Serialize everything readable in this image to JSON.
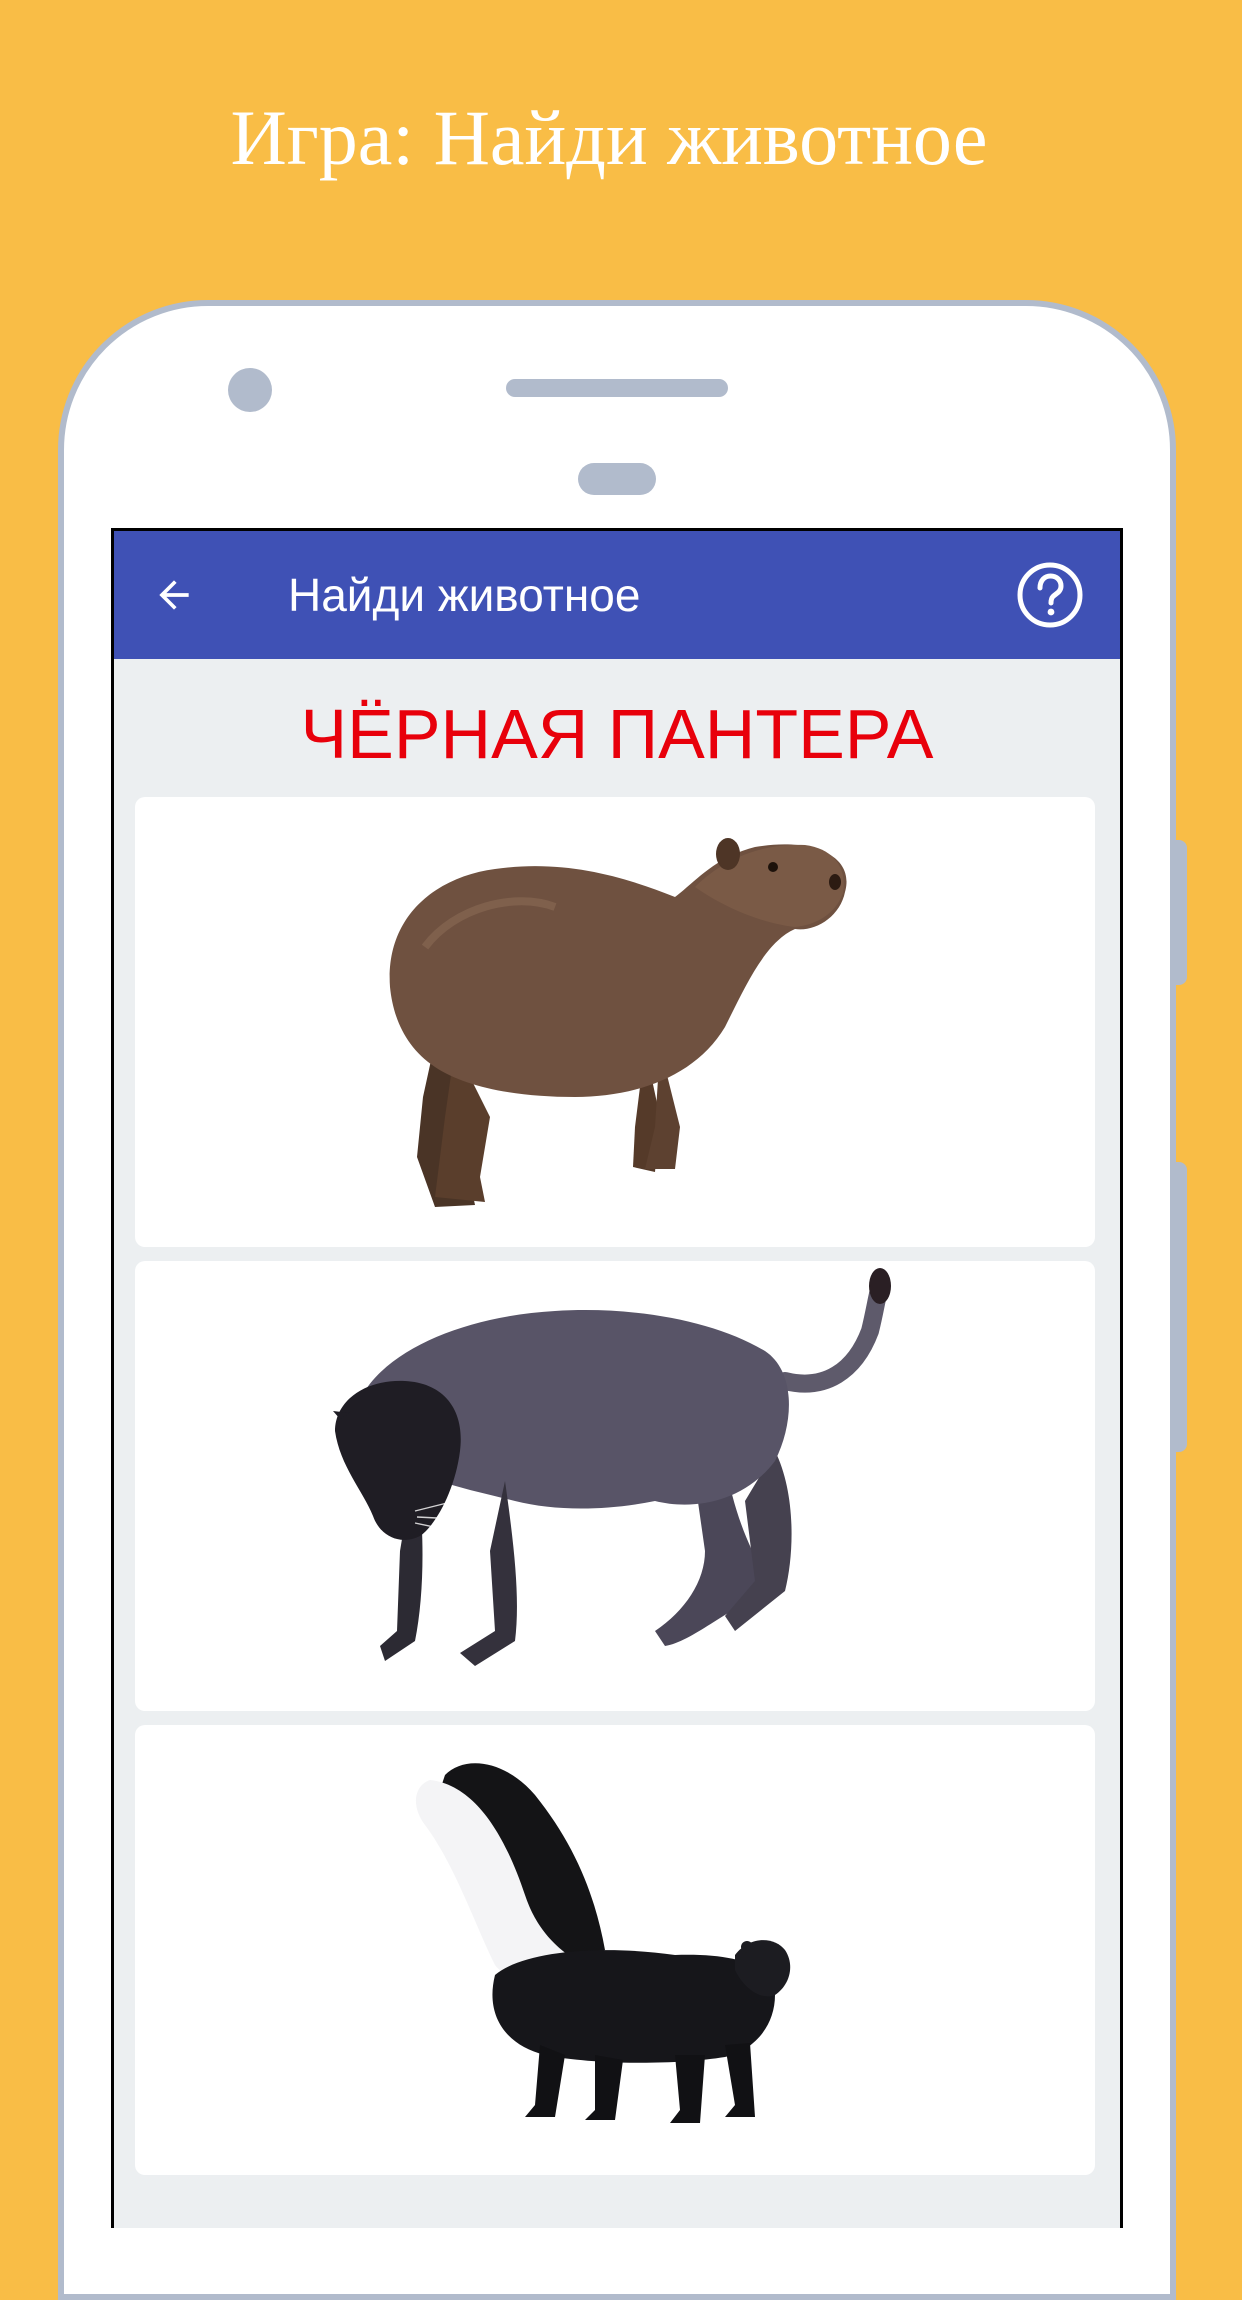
{
  "promo": {
    "title": "Игра: Найди животное"
  },
  "app_bar": {
    "title": "Найди животное",
    "back_icon": "arrow-back-icon",
    "help_icon": "help-circle-icon"
  },
  "game": {
    "target_animal": "ЧЁРНАЯ ПАНТЕРА",
    "options": [
      {
        "animal": "capybara"
      },
      {
        "animal": "black-panther"
      },
      {
        "animal": "skunk"
      }
    ]
  },
  "colors": {
    "background": "#f9bd46",
    "app_bar": "#3f51b5",
    "target_text": "#e8000b",
    "phone_frame": "#b1bbcc"
  }
}
